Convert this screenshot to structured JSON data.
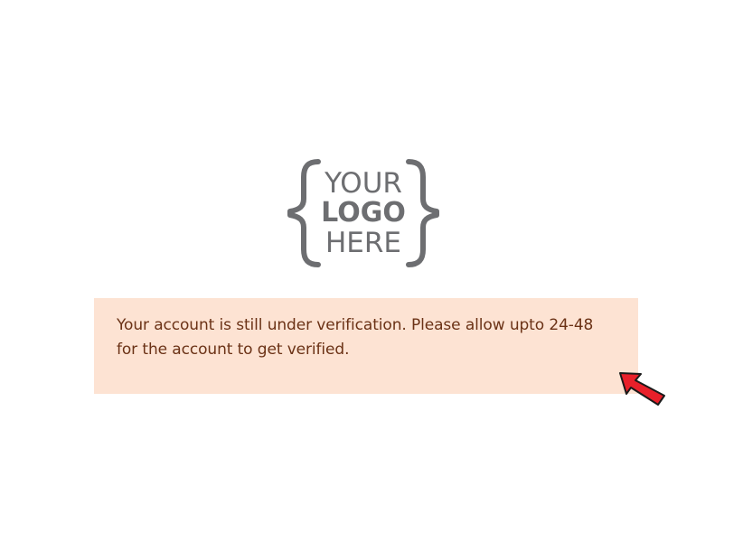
{
  "logo": {
    "line1": "YOUR",
    "line2": "LOGO",
    "line3": "HERE"
  },
  "alert": {
    "message": "Your account is still under verification. Please allow upto 24-48 for the account to get verified."
  },
  "colors": {
    "alert_background": "#fde3d3",
    "alert_text": "#6b3216",
    "logo_gray": "#6d6e71",
    "cursor_red": "#e8202a"
  },
  "icons": {
    "cursor": "red-arrow-cursor-icon"
  }
}
